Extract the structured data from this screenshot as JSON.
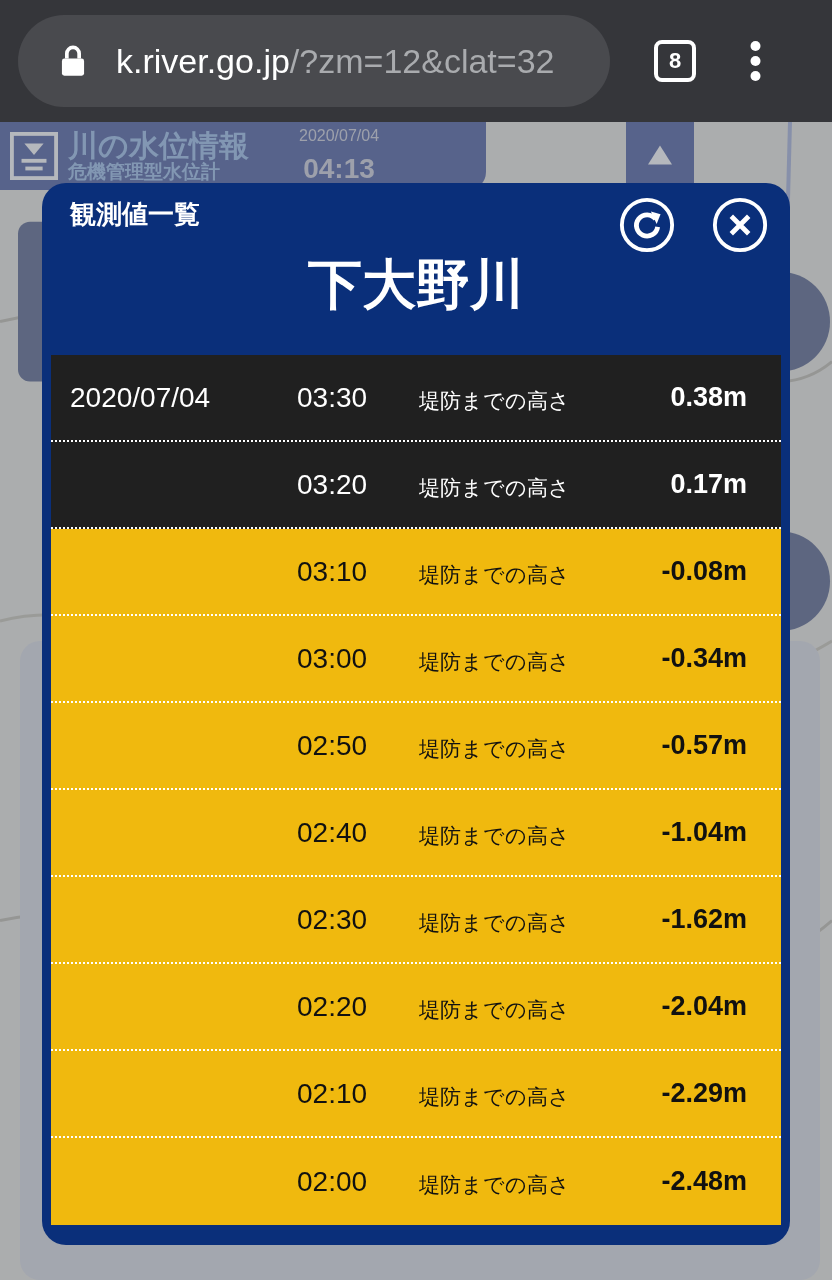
{
  "browser": {
    "url_host": "k.river.go.jp",
    "url_rest": "/?zm=12&clat=32",
    "tab_count": "8"
  },
  "header": {
    "title": "川の水位情報",
    "subtitle": "危機管理型水位計",
    "date": "2020/07/04",
    "time": "04:13"
  },
  "dialog": {
    "caption": "観測値一覧",
    "river": "下大野川",
    "rows": [
      {
        "date": "2020/07/04",
        "time": "03:30",
        "label": "堤防までの高さ",
        "value": "0.38m",
        "kind": "above"
      },
      {
        "time": "03:20",
        "label": "堤防までの高さ",
        "value": "0.17m",
        "kind": "above"
      },
      {
        "time": "03:10",
        "label": "堤防までの高さ",
        "value": "-0.08m",
        "kind": "below"
      },
      {
        "time": "03:00",
        "label": "堤防までの高さ",
        "value": "-0.34m",
        "kind": "below"
      },
      {
        "time": "02:50",
        "label": "堤防までの高さ",
        "value": "-0.57m",
        "kind": "below"
      },
      {
        "time": "02:40",
        "label": "堤防までの高さ",
        "value": "-1.04m",
        "kind": "below"
      },
      {
        "time": "02:30",
        "label": "堤防までの高さ",
        "value": "-1.62m",
        "kind": "below"
      },
      {
        "time": "02:20",
        "label": "堤防までの高さ",
        "value": "-2.04m",
        "kind": "below"
      },
      {
        "time": "02:10",
        "label": "堤防までの高さ",
        "value": "-2.29m",
        "kind": "below"
      },
      {
        "time": "02:00",
        "label": "堤防までの高さ",
        "value": "-2.48m",
        "kind": "below"
      }
    ]
  }
}
